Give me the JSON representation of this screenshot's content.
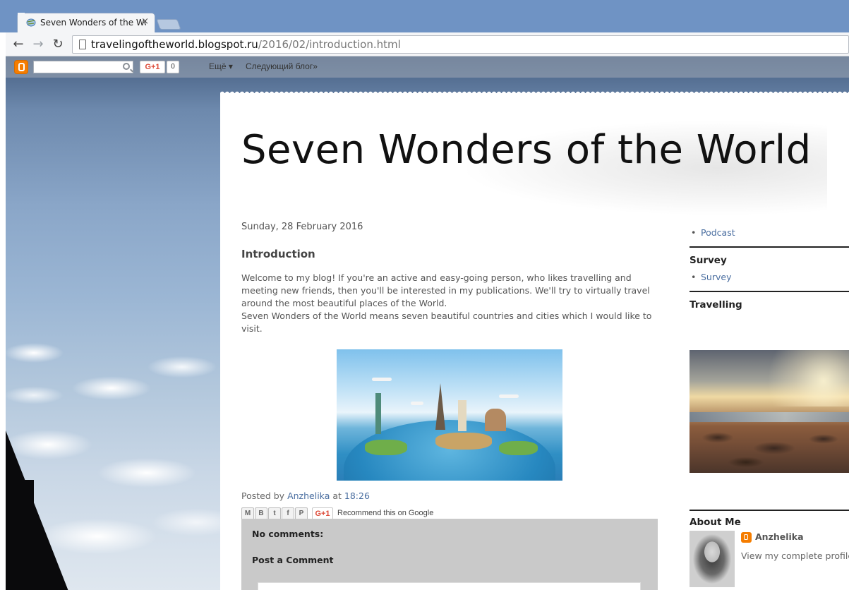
{
  "browser": {
    "tab_title": "Seven Wonders of the Wo",
    "close_glyph": "×",
    "url_host": "travelingoftheworld.blogspot.ru",
    "url_path": "/2016/02/introduction.html",
    "back_glyph": "←",
    "forward_glyph": "→",
    "reload_glyph": "↻"
  },
  "navbar": {
    "gplus_label": "G+1",
    "gplus_count": "0",
    "more_label": "Ещё ▾",
    "next_blog_label": "Следующий блог»",
    "search_value": ""
  },
  "blog": {
    "title": "Seven Wonders of the World"
  },
  "post": {
    "date": "Sunday, 28 February 2016",
    "title": "Introduction",
    "body_p1": "Welcome to my blog! If you're an active and easy-going person, who likes travelling and meeting new friends, then you'll be interested in my publications. We'll try to virtually travel around the most beautiful places of the World.",
    "body_p2": "Seven Wonders of the World means seven beautiful countries and cities which I would like to visit.",
    "posted_by_label": "Posted by",
    "author": "Anzhelika",
    "at_label": "at",
    "time": "18:26",
    "share": {
      "email": "M",
      "blog": "B",
      "twitter": "t",
      "facebook": "f",
      "pinterest": "P",
      "gplus": "G+1",
      "recommend": "Recommend this on Google"
    }
  },
  "comments": {
    "count_label": "No comments:",
    "post_label": "Post a Comment"
  },
  "sidebar": {
    "pages": [
      {
        "label": "Podcast"
      }
    ],
    "survey_heading": "Survey",
    "survey_items": [
      {
        "label": "Survey"
      }
    ],
    "travelling_heading": "Travelling",
    "about_heading": "About Me",
    "profile_name": "Anzhelika",
    "profile_link": "View my complete profile"
  },
  "colors": {
    "link": "#4a6ea0",
    "blogger_orange": "#f57d00",
    "gplus_red": "#dd4b39",
    "comments_bg": "#c9c9c9",
    "chrome_frame": "#6f93c4"
  },
  "icons": [
    "blogger-icon",
    "search-icon",
    "back-icon",
    "forward-icon",
    "reload-icon",
    "page-icon",
    "close-icon"
  ]
}
